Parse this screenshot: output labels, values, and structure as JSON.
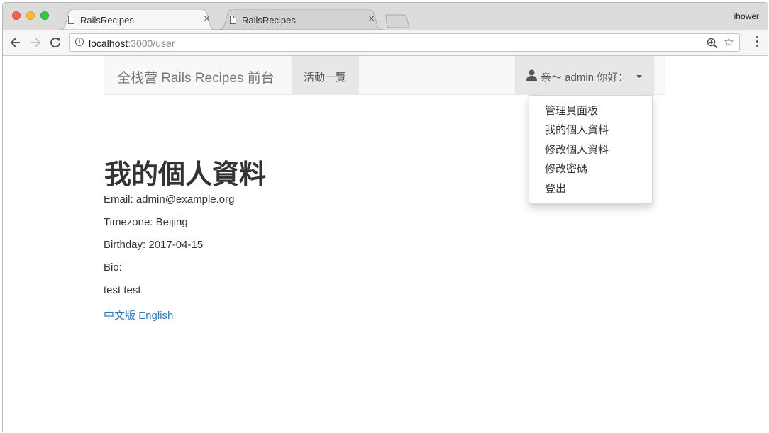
{
  "browser": {
    "tabs": [
      {
        "title": "RailsRecipes",
        "active": true
      },
      {
        "title": "RailsRecipes",
        "active": false
      }
    ],
    "profile_name": "ihower",
    "url_host": "localhost",
    "url_path": ":3000/user",
    "close_glyph": "×"
  },
  "navbar": {
    "brand": "全栈营 Rails Recipes 前台",
    "activities_label": "活動一覽",
    "user_label": "亲～ admin 你好："
  },
  "user_menu": {
    "items": [
      "管理員面板",
      "我的個人資料",
      "修改個人資料",
      "修改密碼",
      "登出"
    ]
  },
  "profile": {
    "heading": "我的個人資料",
    "email": "Email: admin@example.org",
    "timezone": "Timezone: Beijing",
    "birthday": "Birthday: 2017-04-15",
    "bio_label": "Bio:",
    "bio_text": "test test"
  },
  "language_links": {
    "zh": "中文版",
    "en": "English"
  },
  "colors": {
    "link": "#337ab7",
    "navbar_bg": "#f8f8f8",
    "nav_active_bg": "#e7e7e7"
  }
}
